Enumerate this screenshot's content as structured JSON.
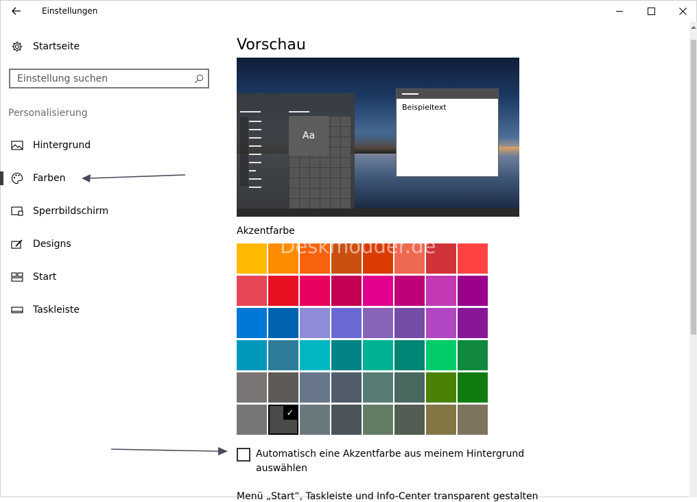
{
  "window": {
    "title": "Einstellungen"
  },
  "sidebar": {
    "home_label": "Startseite",
    "search_placeholder": "Einstellung suchen",
    "section_heading": "Personalisierung",
    "items": [
      {
        "label": "Hintergrund",
        "icon": "image-icon",
        "selected": false
      },
      {
        "label": "Farben",
        "icon": "palette-icon",
        "selected": true
      },
      {
        "label": "Sperrbildschirm",
        "icon": "lockscreen-icon",
        "selected": false
      },
      {
        "label": "Designs",
        "icon": "designs-icon",
        "selected": false
      },
      {
        "label": "Start",
        "icon": "start-icon",
        "selected": false
      },
      {
        "label": "Taskleiste",
        "icon": "taskbar-icon",
        "selected": false
      }
    ]
  },
  "main": {
    "title": "Vorschau",
    "preview": {
      "tile_text": "Aa",
      "window_text": "Beispieltext"
    },
    "accent_label": "Akzentfarbe",
    "watermark": "Deskmodder.de",
    "selected_swatch": {
      "row": 5,
      "col": 1
    },
    "swatches": [
      [
        "#FFB900",
        "#FF8C00",
        "#F7630C",
        "#CA5010",
        "#DA3B01",
        "#EF6950",
        "#D13438",
        "#FF4343"
      ],
      [
        "#E74856",
        "#E81123",
        "#EA005E",
        "#C30052",
        "#E3008C",
        "#BF0077",
        "#C239B3",
        "#9A0089"
      ],
      [
        "#0078D7",
        "#0063B1",
        "#8E8CD8",
        "#6B69D6",
        "#8764B8",
        "#744DA9",
        "#B146C2",
        "#881798"
      ],
      [
        "#0099BC",
        "#2D7D9A",
        "#00B7C3",
        "#038387",
        "#00B294",
        "#018574",
        "#00CC6A",
        "#10893E"
      ],
      [
        "#7A7574",
        "#5D5A58",
        "#68768A",
        "#515C6B",
        "#567C73",
        "#486860",
        "#498205",
        "#107C10"
      ],
      [
        "#767676",
        "#4C4A48",
        "#69797E",
        "#4A5459",
        "#647C64",
        "#525E54",
        "#847545",
        "#7E735F"
      ]
    ],
    "auto_accent_label": "Automatisch eine Akzentfarbe aus meinem Hintergrund auswählen",
    "cut_text": "Menü „Start“, Taskleiste und Info-Center transparent gestalten"
  },
  "colors": {
    "selection_bar": "#3c3c3c",
    "annotation_arrow": "#4a4a5a"
  }
}
